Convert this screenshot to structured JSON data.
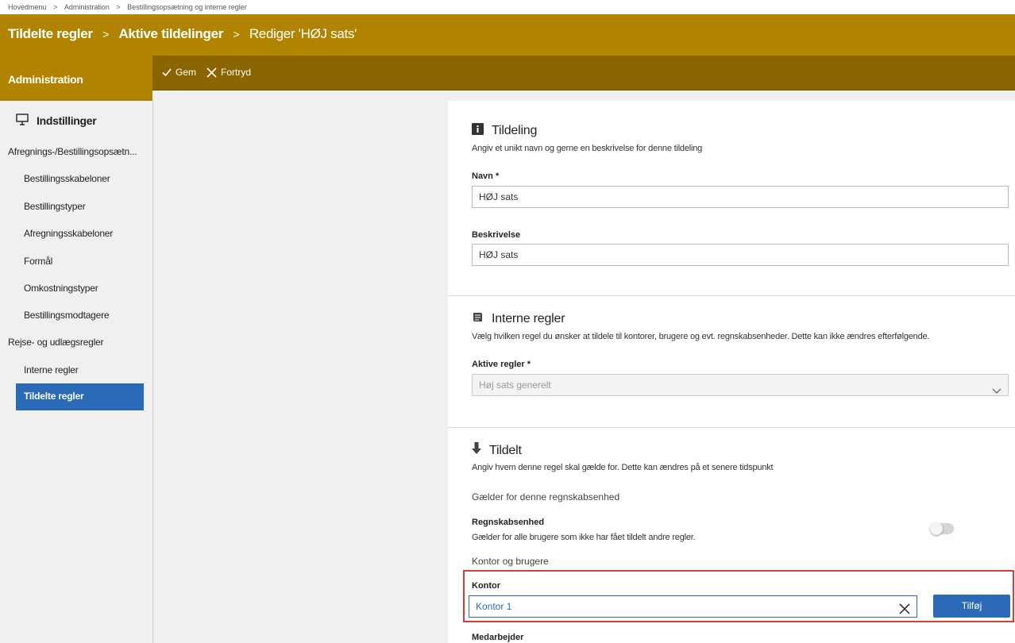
{
  "breadcrumb": [
    "Hovedmenu",
    "Administration",
    "Bestillingsopsætning og interne regler"
  ],
  "breadcrumb_separator": ">",
  "title_bar": {
    "crumb1": "Tildelte regler",
    "crumb2": "Aktive tildelinger",
    "crumb3": "Rediger 'HØJ sats'",
    "separator": ">"
  },
  "sidebar_header": "Administration",
  "toolbar": {
    "save_label": "Gem",
    "cancel_label": "Fortryd"
  },
  "sidebar": {
    "group_label": "Indstillinger",
    "group_icon": "monitor-icon",
    "items": [
      {
        "label": "Afregnings-/Bestillingsopsætn...",
        "level": 1
      },
      {
        "label": "Bestillingsskabeloner",
        "level": 2
      },
      {
        "label": "Bestillingstyper",
        "level": 2
      },
      {
        "label": "Afregningsskabeloner",
        "level": 2
      },
      {
        "label": "Formål",
        "level": 2
      },
      {
        "label": "Omkostningstyper",
        "level": 2
      },
      {
        "label": "Bestillingsmodtagere",
        "level": 2
      },
      {
        "label": "Rejse- og udlægsregler",
        "level": 1
      },
      {
        "label": "Interne regler",
        "level": 2
      },
      {
        "label": "Tildelte regler",
        "level": 2,
        "active": true
      }
    ]
  },
  "tildeling": {
    "icon": "info-icon",
    "title": "Tildeling",
    "description": "Angiv et unikt navn og gerne en beskrivelse for denne tildeling",
    "name_label": "Navn *",
    "name_value": "HØJ sats",
    "description_label": "Beskrivelse",
    "description_value": "HØJ sats"
  },
  "interne_regler": {
    "icon": "scroll-icon",
    "title": "Interne regler",
    "description": "Vælg hvilken regel du ønsker at tildele til kontorer, brugere og evt. regnskabsenheder. Dette kan ikke ændres efterfølgende.",
    "active_rules_label": "Aktive regler *",
    "active_rules_value": "Høj sats generelt"
  },
  "tildelt": {
    "icon": "arrow-down-icon",
    "title": "Tildelt",
    "description": "Angiv hvem denne regel skal gælde for. Dette kan ændres på et senere tidspunkt",
    "applies_heading": "Gælder for denne regnskabsenhed",
    "unit_label": "Regnskabsenhed",
    "unit_desc": "Gælder for alle brugere som ikke har fået tildelt andre regler.",
    "unit_toggle_on": false,
    "office_users_heading": "Kontor og brugere",
    "office_label": "Kontor",
    "office_value": "Kontor 1",
    "add_button": "Tilføj",
    "employee_label": "Medarbejder"
  },
  "colors": {
    "header_gold": "#b08300",
    "toolbar_dark": "#8a6500",
    "accent_blue": "#2a6ab7",
    "highlight_red": "#d43f3a"
  }
}
